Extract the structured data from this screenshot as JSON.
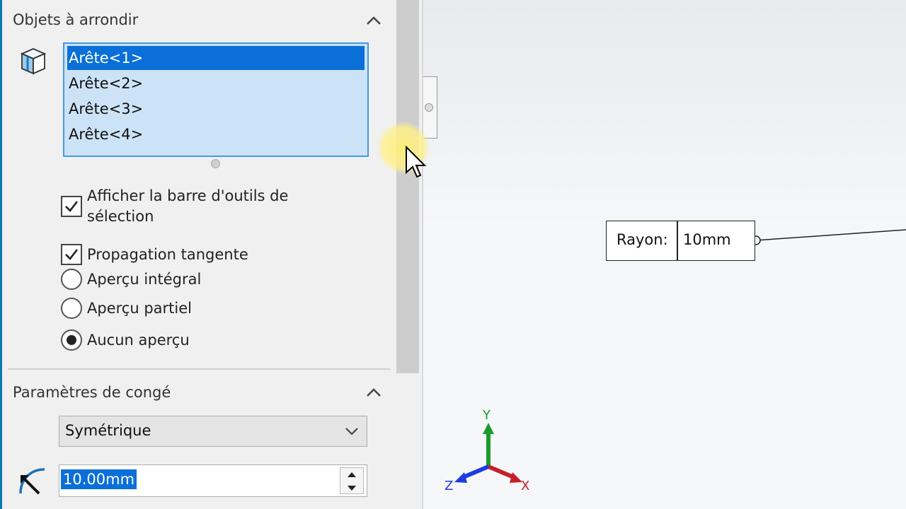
{
  "objets_section": {
    "title": "Objets à arrondir",
    "edges": [
      {
        "label": "Arête<1>",
        "selected": true
      },
      {
        "label": "Arête<2>",
        "selected": false
      },
      {
        "label": "Arête<3>",
        "selected": false
      },
      {
        "label": "Arête<4>",
        "selected": false
      }
    ],
    "options": {
      "show_selection_toolbar": {
        "line1": "Afficher la barre d'outils de",
        "line2": "sélection",
        "checked": true
      },
      "tangent_propagation": {
        "label": "Propagation tangente",
        "checked": true
      },
      "preview_full": {
        "label": "Aperçu intégral",
        "selected": false
      },
      "preview_partial": {
        "label": "Aperçu partiel",
        "selected": false
      },
      "preview_none": {
        "label": "Aucun aperçu",
        "selected": true
      }
    }
  },
  "params_section": {
    "title": "Paramètres de congé",
    "type_value": "Symétrique",
    "radius_value": "10.00mm"
  },
  "viewport": {
    "callout_label": "Rayon:",
    "callout_value": "10mm",
    "triad": {
      "x": "X",
      "y": "Y",
      "z": "Z"
    }
  },
  "colors": {
    "accent": "#0a6fd8",
    "list_bg": "#cce3f7",
    "axis_x": "#c8202a",
    "axis_y": "#1c9a2c",
    "axis_z": "#1f3ce0"
  },
  "icons": [
    "edge-cube-icon",
    "chevron-up-icon",
    "chevron-down-icon",
    "checkmark-icon",
    "fillet-radius-icon",
    "spin-up-icon",
    "spin-down-icon",
    "mouse-cursor-icon",
    "axis-triad-icon"
  ]
}
